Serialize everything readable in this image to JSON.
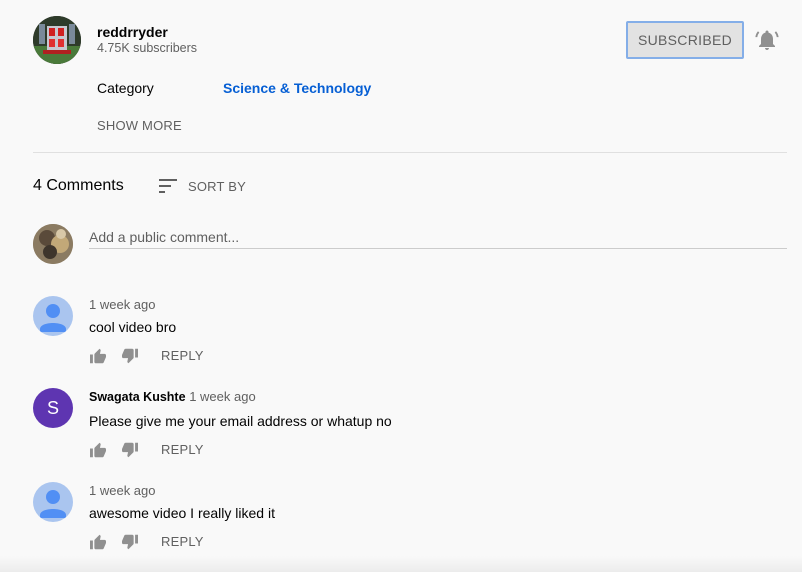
{
  "channel": {
    "name": "reddrryder",
    "subscribers": "4.75K subscribers",
    "subscribe_label": "SUBSCRIBED",
    "avatar_icon": "channel-avatar-icon",
    "bell_icon": "bell-icon"
  },
  "meta": {
    "category_label": "Category",
    "category_value": "Science & Technology",
    "show_more": "SHOW MORE"
  },
  "comments_header": {
    "count": "4 Comments",
    "sort_label": "SORT BY",
    "sort_icon": "sort-icon"
  },
  "add_comment": {
    "placeholder": "Add a public comment..."
  },
  "comments": [
    {
      "author": "",
      "time": "1 week ago",
      "text": "cool video bro",
      "avatar": "default-user-icon",
      "reply": "REPLY"
    },
    {
      "author": "Swagata Kushte",
      "time": "1 week ago",
      "text": "Please give me your email address or whatup no",
      "avatar_letter": "S",
      "reply": "REPLY"
    },
    {
      "author": "",
      "time": "1 week ago",
      "text": "awesome video I really liked it",
      "avatar": "default-user-icon",
      "reply": "REPLY"
    }
  ],
  "colors": {
    "link_blue": "#065fd4",
    "subscribe_border": "#84aee8",
    "letter_avatar": "#5e35b1",
    "default_avatar": "#aac5ef"
  }
}
